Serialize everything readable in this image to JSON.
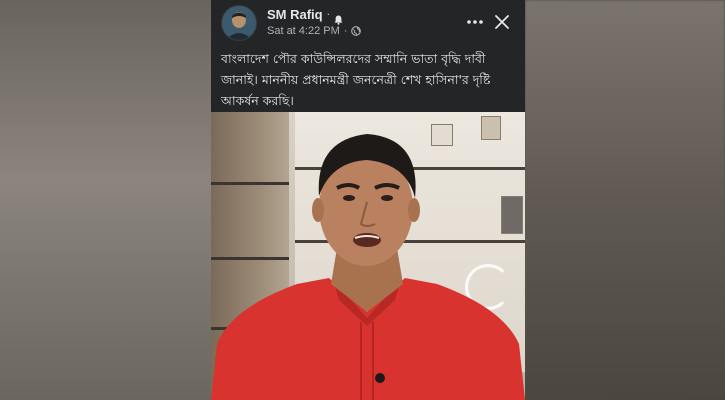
{
  "post": {
    "author": "SM Rafiq",
    "separator": "·",
    "timestamp": "Sat at 4:22 PM",
    "meta_separator": "·",
    "text": "বাংলাদেশ পৌর কাউন্সিলরদের সম্মানি ভাতা বৃদ্ধি দাবী\nজানাই। মাননীয় প্রধানমন্ত্রী জননেত্রী শেখ হাসিনা'র দৃষ্টি\nআকর্ষন করছি।",
    "icons": {
      "notification": "bell-icon",
      "privacy": "globe-icon",
      "more": "more-options-icon",
      "close": "close-icon"
    }
  },
  "colors": {
    "post_background": "#242526",
    "primary_text": "#e4e6eb",
    "secondary_text": "#b0b3b8",
    "shirt": "#d8332f"
  }
}
